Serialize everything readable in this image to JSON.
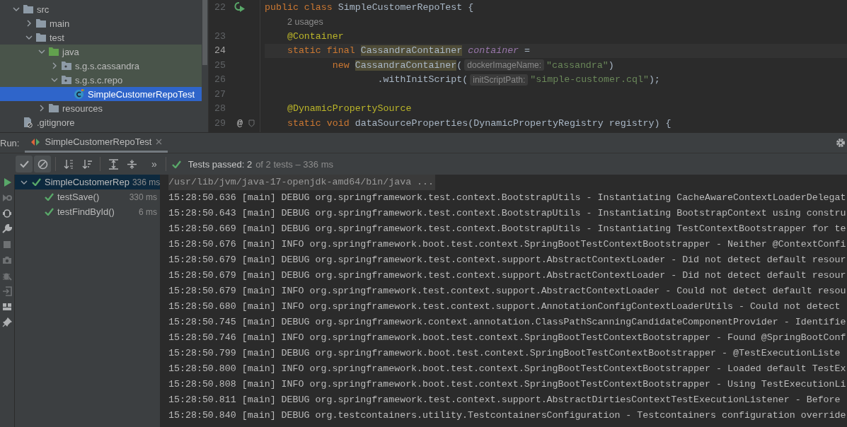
{
  "project_tree": [
    {
      "label": "src",
      "kind": "folder",
      "expanded": true,
      "selected": false,
      "tinted": false,
      "children": [
        {
          "label": "main",
          "kind": "folder",
          "expanded": false,
          "selected": false,
          "tinted": false
        },
        {
          "label": "test",
          "kind": "folder",
          "expanded": true,
          "selected": false,
          "tinted": false,
          "children": [
            {
              "label": "java",
              "kind": "test-root",
              "expanded": true,
              "selected": false,
              "tinted": true,
              "children": [
                {
                  "label": "s.g.s.cassandra",
                  "kind": "package",
                  "expanded": false,
                  "selected": false,
                  "tinted": true
                },
                {
                  "label": "s.g.s.c.repo",
                  "kind": "package",
                  "expanded": true,
                  "selected": false,
                  "tinted": true,
                  "children": [
                    {
                      "label": "SimpleCustomerRepoTest",
                      "kind": "class",
                      "selected": true,
                      "tinted": false
                    }
                  ]
                }
              ]
            },
            {
              "label": "resources",
              "kind": "folder",
              "expanded": false,
              "selected": false,
              "tinted": false
            }
          ]
        }
      ]
    },
    {
      "label": ".gitignore",
      "kind": "ignore-file",
      "selected": false,
      "tinted": false
    }
  ],
  "editor": {
    "lines": [
      {
        "kind": "code",
        "number": "22",
        "run_icon": true,
        "foldable": false,
        "current": false,
        "tokens": [
          {
            "kind": "kw",
            "text": "public "
          },
          {
            "kind": "kw",
            "text": "class "
          },
          {
            "kind": "plain",
            "text": "SimpleCustomerRepoTest {"
          }
        ]
      },
      {
        "kind": "usages",
        "text": "2 usages"
      },
      {
        "kind": "code",
        "number": "23",
        "run_icon": false,
        "foldable": false,
        "current": false,
        "tokens": [
          {
            "kind": "ann",
            "text": "    @Container"
          }
        ]
      },
      {
        "kind": "code",
        "number": "24",
        "run_icon": false,
        "foldable": false,
        "current": true,
        "tokens": [
          {
            "kind": "kw",
            "text": "    static final "
          },
          {
            "kind": "match",
            "text": "CassandraContainer"
          },
          {
            "kind": "field",
            "text": " container"
          },
          {
            "kind": "plain",
            "text": " ="
          }
        ]
      },
      {
        "kind": "code",
        "number": "25",
        "run_icon": false,
        "foldable": false,
        "current": false,
        "tokens": [
          {
            "kind": "kw",
            "text": "            new "
          },
          {
            "kind": "match",
            "text": "CassandraContainer"
          },
          {
            "kind": "plain",
            "text": "("
          },
          {
            "kind": "hint",
            "text": "dockerImageName:"
          },
          {
            "kind": "str",
            "text": "\"cassandra\""
          },
          {
            "kind": "plain",
            "text": ")"
          }
        ]
      },
      {
        "kind": "code",
        "number": "26",
        "run_icon": false,
        "foldable": false,
        "current": false,
        "tokens": [
          {
            "kind": "plain",
            "text": "                    .withInitScript("
          },
          {
            "kind": "hint",
            "text": "initScriptPath:"
          },
          {
            "kind": "str",
            "text": "\"simple-customer.cql\""
          },
          {
            "kind": "plain",
            "text": ");"
          }
        ]
      },
      {
        "kind": "code",
        "number": "27",
        "run_icon": false,
        "foldable": false,
        "current": false
      },
      {
        "kind": "code",
        "number": "28",
        "run_icon": false,
        "foldable": false,
        "current": false,
        "tokens": [
          {
            "kind": "ann",
            "text": "    @DynamicPropertySource"
          }
        ]
      },
      {
        "kind": "code",
        "number": "29",
        "run_icon": false,
        "gutter_mark": "@",
        "foldable": true,
        "current": false,
        "tokens": [
          {
            "kind": "kw",
            "text": "    static void "
          },
          {
            "kind": "plain",
            "text": "dataSourceProperties(DynamicPropertyRegistry registry) {"
          }
        ]
      }
    ]
  },
  "run_panel": {
    "label": "Run:",
    "tab": {
      "title": "SimpleCustomerRepoTest",
      "selected": true
    },
    "toolbar": [
      {
        "kind": "check-toggle",
        "selected": true
      },
      {
        "kind": "cancel-toggle",
        "selected": true
      },
      {
        "kind": "sort-alpha"
      },
      {
        "kind": "sort-duration"
      },
      {
        "kind": "expand-all"
      },
      {
        "kind": "collapse-all"
      },
      {
        "kind": "more",
        "text": "»"
      }
    ],
    "status": {
      "passed": "Tests passed: 2",
      "detail": "of 2 tests – 336 ms"
    },
    "side_tools": [
      {
        "kind": "play",
        "disabled": false
      },
      {
        "kind": "rerun-failed",
        "disabled": true
      },
      {
        "kind": "toggle-auto",
        "disabled": false
      },
      {
        "kind": "wrench",
        "disabled": false
      },
      {
        "kind": "stop",
        "disabled": true
      },
      {
        "kind": "camera",
        "disabled": true
      },
      {
        "kind": "bug",
        "disabled": true
      },
      {
        "kind": "exit",
        "disabled": true
      },
      {
        "kind": "layout",
        "disabled": false
      },
      {
        "kind": "pin",
        "disabled": false
      }
    ],
    "tests": [
      {
        "name": "SimpleCustomerRep",
        "duration": "336 ms",
        "passed": true,
        "expanded": true,
        "selected": true,
        "children": [
          {
            "name": "testSave()",
            "duration": "330 ms",
            "passed": true,
            "selected": false
          },
          {
            "name": "testFindById()",
            "duration": "6 ms",
            "passed": true,
            "selected": false
          }
        ]
      }
    ],
    "console": {
      "command": "/usr/lib/jvm/java-17-openjdk-amd64/bin/java ...",
      "lines": [
        "15:28:50.636 [main] DEBUG org.springframework.test.context.BootstrapUtils - Instantiating CacheAwareContextLoaderDelegat",
        "15:28:50.643 [main] DEBUG org.springframework.test.context.BootstrapUtils - Instantiating BootstrapContext using constru",
        "15:28:50.669 [main] DEBUG org.springframework.test.context.BootstrapUtils - Instantiating TestContextBootstrapper for te",
        "15:28:50.676 [main] INFO org.springframework.boot.test.context.SpringBootTestContextBootstrapper - Neither @ContextConfi",
        "15:28:50.679 [main] DEBUG org.springframework.test.context.support.AbstractContextLoader - Did not detect default resour",
        "15:28:50.679 [main] DEBUG org.springframework.test.context.support.AbstractContextLoader - Did not detect default resour",
        "15:28:50.679 [main] INFO org.springframework.test.context.support.AbstractContextLoader - Could not detect default resou",
        "15:28:50.680 [main] INFO org.springframework.test.context.support.AnnotationConfigContextLoaderUtils - Could not detect",
        "15:28:50.745 [main] DEBUG org.springframework.context.annotation.ClassPathScanningCandidateComponentProvider - Identifie",
        "15:28:50.746 [main] INFO org.springframework.boot.test.context.SpringBootTestContextBootstrapper - Found @SpringBootConf",
        "15:28:50.799 [main] DEBUG org.springframework.boot.test.context.SpringBootTestContextBootstrapper - @TestExecutionListe",
        "15:28:50.800 [main] INFO org.springframework.boot.test.context.SpringBootTestContextBootstrapper - Loaded default TestEx",
        "15:28:50.808 [main] INFO org.springframework.boot.test.context.SpringBootTestContextBootstrapper - Using TestExecutionLi",
        "15:28:50.811 [main] DEBUG org.springframework.test.context.support.AbstractDirtiesContextTestExecutionListener - Before",
        "15:28:50.840 [main] DEBUG org.testcontainers.utility.TestcontainersConfiguration - Testcontainers configuration override"
      ]
    }
  }
}
